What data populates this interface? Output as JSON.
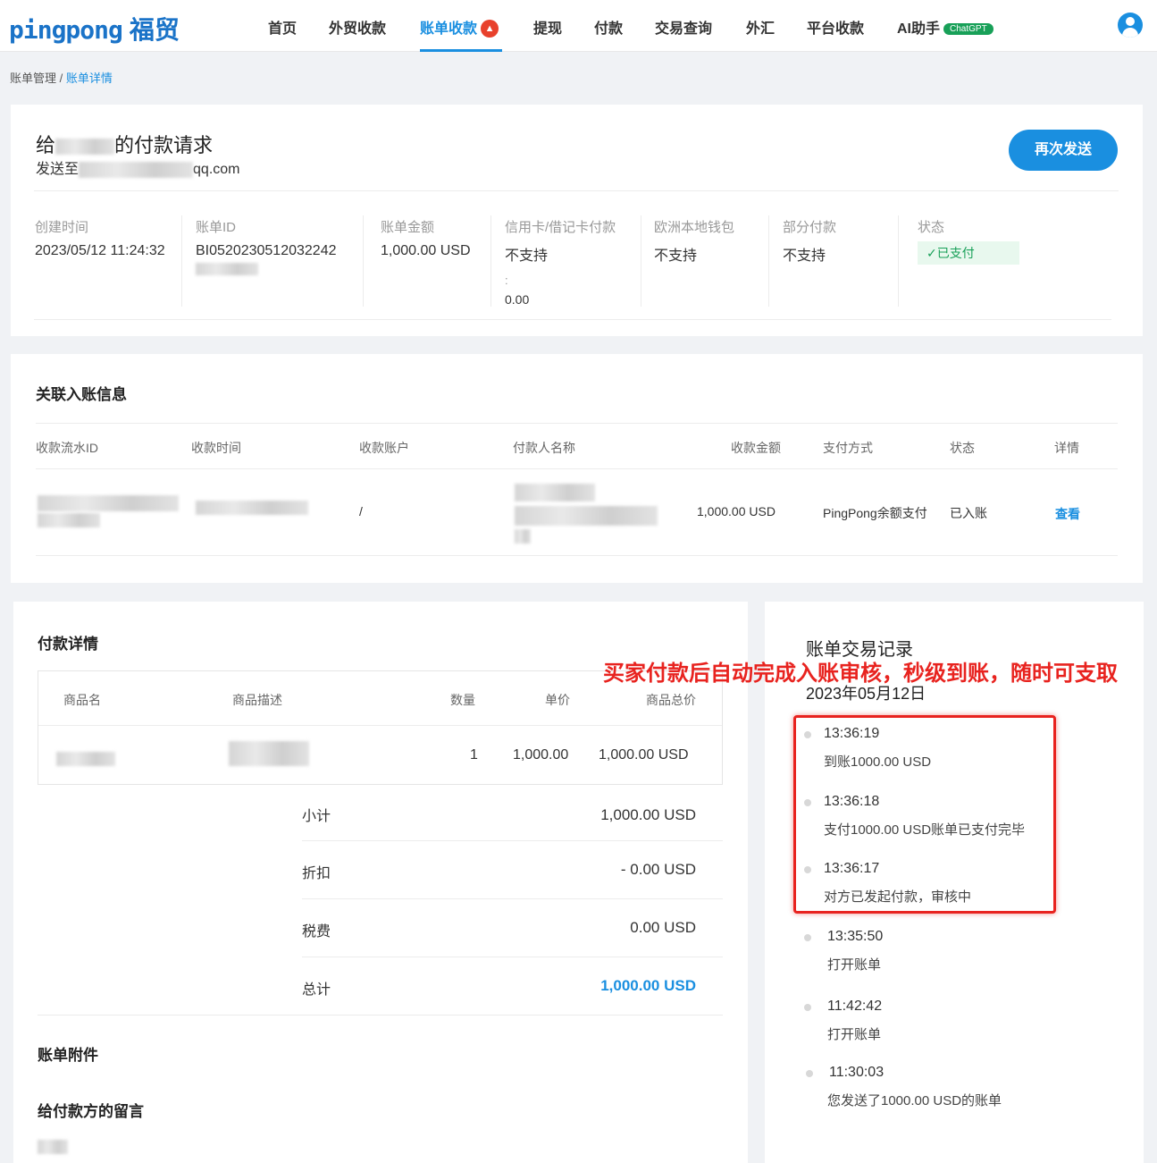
{
  "nav": {
    "logo_en": "pingpong",
    "logo_cn": "福贸",
    "items": [
      "首页",
      "外贸收款",
      "账单收款",
      "提现",
      "付款",
      "交易查询",
      "外汇",
      "平台收款",
      "AI助手"
    ],
    "chatgpt_badge": "ChatGPT",
    "active_index": 2
  },
  "breadcrumb": {
    "parent": "账单管理 /",
    "current": "账单详情"
  },
  "request": {
    "title_prefix": "给",
    "title_suffix": "的付款请求",
    "to_prefix": "发送至",
    "to_suffix": "qq.com",
    "resend_label": "再次发送"
  },
  "info": {
    "created": {
      "label": "创建时间",
      "value": "2023/05/12 11:24:32"
    },
    "bill_id": {
      "label": "账单ID",
      "value": "BI0520230512032242"
    },
    "amount": {
      "label": "账单金额",
      "value": "1,000.00 USD"
    },
    "card_pay": {
      "label": "信用卡/借记卡付款",
      "value": "不支持",
      "extra_colon": ":",
      "extra_value": "0.00"
    },
    "eu_wallet": {
      "label": "欧洲本地钱包",
      "value": "不支持"
    },
    "partial": {
      "label": "部分付款",
      "value": "不支持"
    },
    "status": {
      "label": "状态",
      "value": "已支付"
    }
  },
  "linked": {
    "title": "关联入账信息",
    "headers": [
      "收款流水ID",
      "收款时间",
      "收款账户",
      "付款人名称",
      "收款金额",
      "支付方式",
      "状态",
      "详情"
    ],
    "row": {
      "account": "/",
      "amount": "1,000.00 USD",
      "method": "PingPong余额支付",
      "status": "已入账",
      "detail": "查看"
    }
  },
  "payment": {
    "title": "付款详情",
    "headers": [
      "商品名",
      "商品描述",
      "数量",
      "单价",
      "商品总价"
    ],
    "row": {
      "qty": "1",
      "unit": "1,000.00",
      "total": "1,000.00 USD"
    },
    "summary": [
      {
        "label": "小计",
        "value": "1,000.00 USD"
      },
      {
        "label": "折扣",
        "value": "- 0.00 USD"
      },
      {
        "label": "税费",
        "value": "0.00 USD"
      },
      {
        "label": "总计",
        "value": "1,000.00 USD"
      }
    ],
    "attachments": "账单附件",
    "message": "给付款方的留言"
  },
  "records": {
    "title": "账单交易记录",
    "annotation": "买家付款后自动完成入账审核，秒级到账，随时可支取",
    "date": "2023年05月12日",
    "events": [
      {
        "time": "13:36:19",
        "desc": "到账1000.00 USD"
      },
      {
        "time": "13:36:18",
        "desc": "支付1000.00 USD账单已支付完毕"
      },
      {
        "time": "13:36:17",
        "desc": "对方已发起付款，审核中"
      },
      {
        "time": "13:35:50",
        "desc": "打开账单"
      },
      {
        "time": "11:42:42",
        "desc": "打开账单"
      },
      {
        "time": "11:30:03",
        "desc": "您发送了1000.00 USD的账单"
      }
    ]
  },
  "colors": {
    "accent": "#1a8fe0",
    "annotation": "#e8231f",
    "paid": "#18a058"
  }
}
